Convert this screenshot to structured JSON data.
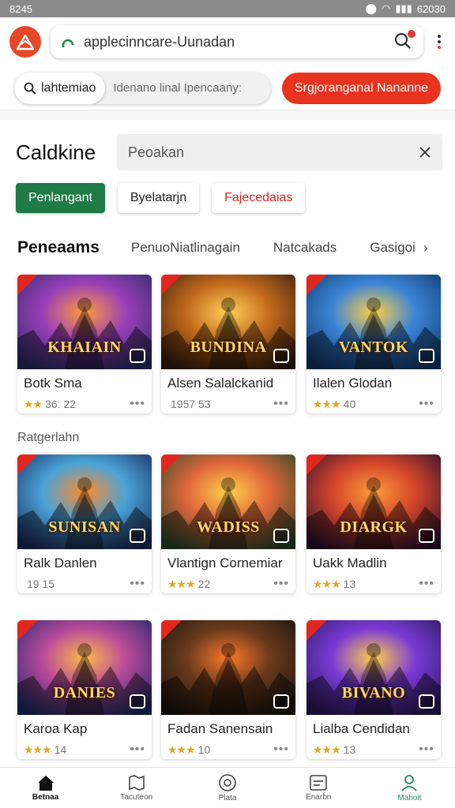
{
  "status_bar": {
    "time": "8245",
    "right_text": "62030"
  },
  "app_bar": {
    "url": "applecinncare-Uunadan"
  },
  "toolbar": {
    "seg_active_label": "lahtemiao",
    "seg_other_label": "Idenano linal Ipencaany:",
    "red_button_label": "Srgjoranganal Nananne"
  },
  "catalog": {
    "title": "Caldkine",
    "search_placeholder": "Peoakan"
  },
  "chips": [
    "Penlangant",
    "Byelatarjn",
    "Fajecedaias"
  ],
  "tabs": {
    "active": "Peneaams",
    "items": [
      "PenuoNiatlinagain",
      "Natcakads",
      "Gasigoi"
    ]
  },
  "section_label": "Ratgerlahn",
  "cards": [
    {
      "thumb_title": "KHAIAIN",
      "name": "Botk Sma",
      "rating": "36ː 22",
      "stars": "★★",
      "palette": [
        "#2b2d6b",
        "#9a3fb8",
        "#ff9a3c"
      ]
    },
    {
      "thumb_title": "BUNDINA",
      "name": "Alsen Salalckanid",
      "rating": "1957 53",
      "stars": "",
      "palette": [
        "#3a1d0e",
        "#c26a1c",
        "#ffd05a"
      ]
    },
    {
      "thumb_title": "VANTOK",
      "name": "Ilalen Glodan",
      "rating": "40",
      "stars": "★★★",
      "palette": [
        "#0f3a6e",
        "#3b84d6",
        "#ffcf4a"
      ]
    },
    {
      "thumb_title": "SUNISAN",
      "name": "Ralk Danlen",
      "rating": "19 15",
      "stars": "",
      "palette": [
        "#1b2b5e",
        "#4aa3d8",
        "#ff8a2a"
      ]
    },
    {
      "thumb_title": "WADISS",
      "name": "Vlantign Cornemiar",
      "rating": "22",
      "stars": "★★★",
      "palette": [
        "#2a4a2a",
        "#e0663a",
        "#ffd24a"
      ]
    },
    {
      "thumb_title": "DIARGK",
      "name": "Uakk Madlin",
      "rating": "13",
      "stars": "★★★",
      "palette": [
        "#2a0f2e",
        "#d3452a",
        "#ff9b3a"
      ]
    },
    {
      "thumb_title": "DANIES",
      "name": "Karoa Kap",
      "rating": "14",
      "stars": "★★★",
      "palette": [
        "#1d2a6a",
        "#b84a9a",
        "#ffb84a"
      ]
    },
    {
      "thumb_title": "",
      "name": "Fadan Sanensain",
      "rating": "10",
      "stars": "★★★",
      "palette": [
        "#1a1410",
        "#6a3a1c",
        "#ff7a2a"
      ]
    },
    {
      "thumb_title": "BIVANO",
      "name": "Lialba Cendidan",
      "rating": "13",
      "stars": "★★★",
      "palette": [
        "#2a1a5e",
        "#7a3ad6",
        "#ffcf4a"
      ]
    }
  ],
  "bottom_nav": [
    {
      "label": "Betnaa",
      "icon": "home-icon"
    },
    {
      "label": "Tacuteon",
      "icon": "map-icon"
    },
    {
      "label": "Plata",
      "icon": "circle-icon"
    },
    {
      "label": "Enarbn",
      "icon": "image-icon"
    },
    {
      "label": "Mahoit",
      "icon": "person-icon"
    }
  ],
  "colors": {
    "accent_red": "#e8331f",
    "accent_green": "#1f7a46",
    "logo_red": "#e8482a"
  }
}
